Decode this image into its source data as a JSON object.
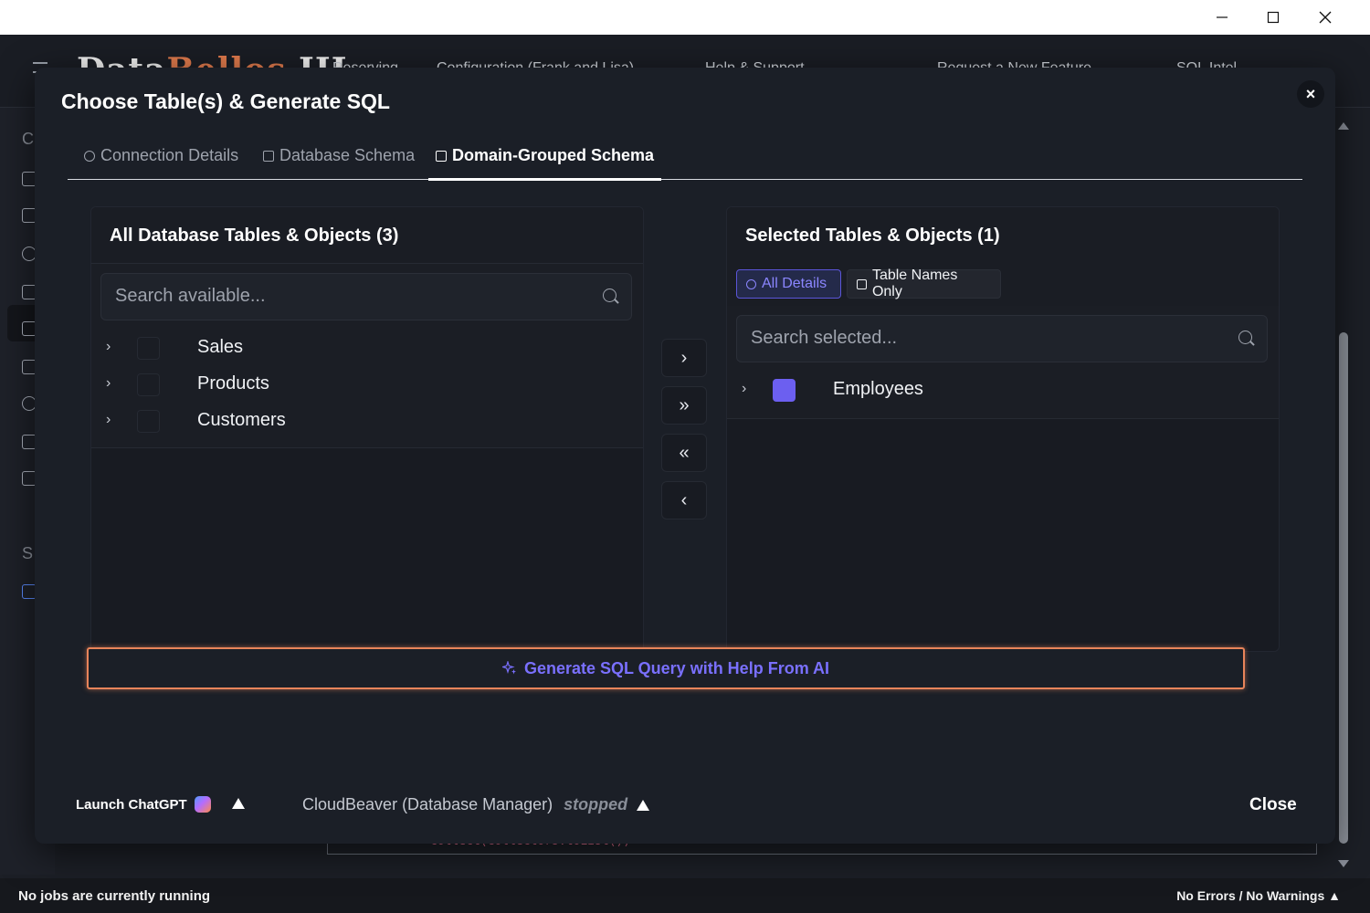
{
  "window": {
    "minimize": "—",
    "maximize": "☐",
    "close": "✕"
  },
  "app": {
    "logo_main": "Data",
    "logo_accent": "Bellos",
    "logo_suffix": "III",
    "nav": [
      "Reserving",
      "Configuration (Frank and Lisa)",
      "Help & Support",
      "Request a New Feature",
      "SQL Intel"
    ],
    "rail_letters": [
      "C",
      "S"
    ],
    "editor_line": "collect(Collectors.toList())"
  },
  "modal": {
    "title": "Choose Table(s) & Generate SQL",
    "close": "×",
    "tabs": [
      {
        "label": "Connection Details",
        "icon": "gear-icon"
      },
      {
        "label": "Database Schema",
        "icon": "book-icon"
      },
      {
        "label": "Domain-Grouped Schema",
        "icon": "group-icon"
      }
    ],
    "active_tab": 2,
    "available": {
      "title": "All Database Tables & Objects (3)",
      "search_placeholder": "Search available...",
      "items": [
        {
          "label": "Sales",
          "checked": false
        },
        {
          "label": "Products",
          "checked": false
        },
        {
          "label": "Customers",
          "checked": false
        }
      ]
    },
    "selected": {
      "title": "Selected Tables & Objects (1)",
      "toggle_all": "All Details",
      "toggle_names": "Table Names Only",
      "search_placeholder": "Search selected...",
      "items": [
        {
          "label": "Employees",
          "checked": true
        }
      ]
    },
    "transfer": {
      "move_one": "›",
      "move_all": "»",
      "remove_all": "«",
      "remove_one": "‹"
    },
    "ai_button": "Generate SQL Query with Help From AI",
    "footer": {
      "launch": "Launch ChatGPT",
      "cloudbeaver": "CloudBeaver (Database Manager)",
      "status": "stopped",
      "close": "Close"
    }
  },
  "statusbar": {
    "left": "No jobs are currently running",
    "right": "No Errors / No Warnings ▲"
  },
  "colors": {
    "accent": "#6c5ff0",
    "ai_border": "#e8845a",
    "background": "#1b1f27"
  }
}
